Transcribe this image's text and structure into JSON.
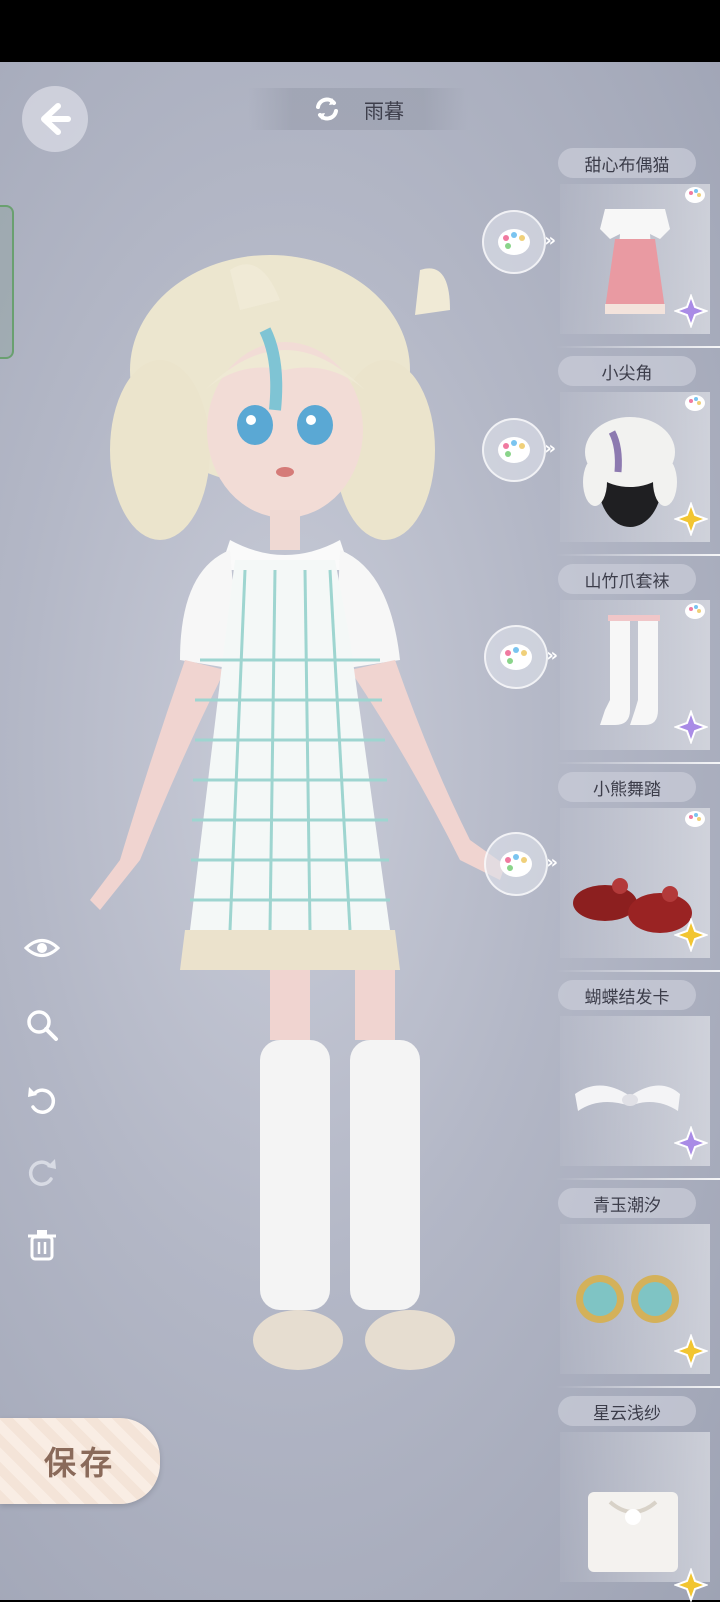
{
  "header": {
    "character_name": "雨暮",
    "back_icon": "arrow-left-icon",
    "switch_icon": "refresh-icon"
  },
  "tools": [
    {
      "name": "view-toggle",
      "icon": "eye-icon"
    },
    {
      "name": "zoom",
      "icon": "magnifier-icon"
    },
    {
      "name": "undo",
      "icon": "undo-icon"
    },
    {
      "name": "redo",
      "icon": "redo-icon"
    },
    {
      "name": "delete",
      "icon": "trash-icon"
    }
  ],
  "items": [
    {
      "title": "甜心布偶猫",
      "rarity": "purple",
      "has_dye": true
    },
    {
      "title": "小尖角",
      "rarity": "gold",
      "has_dye": true
    },
    {
      "title": "山竹爪套袜",
      "rarity": "purple",
      "has_dye": true
    },
    {
      "title": "小熊舞踏",
      "rarity": "gold",
      "has_dye": true
    },
    {
      "title": "蝴蝶结发卡",
      "rarity": "purple",
      "has_dye": false
    },
    {
      "title": "青玉潮汐",
      "rarity": "gold",
      "has_dye": false
    },
    {
      "title": "星云浅纱",
      "rarity": "gold",
      "has_dye": false
    }
  ],
  "save": {
    "label": "保存"
  },
  "colors": {
    "background": "#b3b7c6",
    "purple_rarity": "#a98be6",
    "gold_rarity": "#f2c530",
    "save_text": "#8a6a5a"
  }
}
